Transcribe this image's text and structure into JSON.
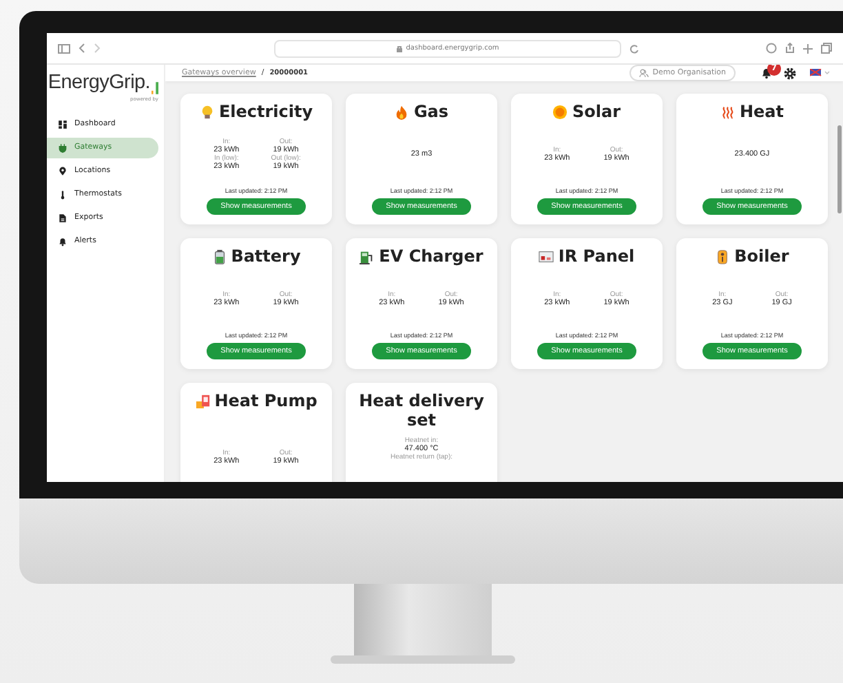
{
  "browser": {
    "url": "dashboard.energygrip.com"
  },
  "brand": {
    "name": "EnergyGrip.",
    "tagline": "powered by"
  },
  "sidebar": {
    "items": [
      {
        "label": "Dashboard",
        "selected": false
      },
      {
        "label": "Gateways",
        "selected": true
      },
      {
        "label": "Locations",
        "selected": false
      },
      {
        "label": "Thermostats",
        "selected": false
      },
      {
        "label": "Exports",
        "selected": false
      },
      {
        "label": "Alerts",
        "selected": false
      }
    ]
  },
  "breadcrumb": {
    "link": "Gateways overview",
    "separator": "/",
    "current": "20000001"
  },
  "topbar": {
    "organisation": "Demo Organisation",
    "notification_count": "7"
  },
  "cards": [
    {
      "title": "Electricity",
      "kind": "pair",
      "readings": [
        {
          "label": "In:",
          "value": "23 kWh"
        },
        {
          "label": "Out:",
          "value": "19 kWh"
        },
        {
          "label": "In (low):",
          "value": "23 kWh"
        },
        {
          "label": "Out (low):",
          "value": "19 kWh"
        }
      ],
      "updated": "Last updated: 2:12 PM",
      "button": "Show measurements"
    },
    {
      "title": "Gas",
      "kind": "single",
      "readings": [
        {
          "value": "23 m3"
        }
      ],
      "updated": "Last updated: 2:12 PM",
      "button": "Show measurements"
    },
    {
      "title": "Solar",
      "kind": "pair",
      "readings": [
        {
          "label": "In:",
          "value": "23 kWh"
        },
        {
          "label": "Out:",
          "value": "19 kWh"
        }
      ],
      "updated": "Last updated: 2:12 PM",
      "button": "Show measurements"
    },
    {
      "title": "Heat",
      "kind": "single",
      "readings": [
        {
          "value": "23.400 GJ"
        }
      ],
      "updated": "Last updated: 2:12 PM",
      "button": "Show measurements"
    },
    {
      "title": "Battery",
      "kind": "pair",
      "readings": [
        {
          "label": "In:",
          "value": "23 kWh"
        },
        {
          "label": "Out:",
          "value": "19 kWh"
        }
      ],
      "updated": "Last updated: 2:12 PM",
      "button": "Show measurements"
    },
    {
      "title": "EV Charger",
      "kind": "pair",
      "readings": [
        {
          "label": "In:",
          "value": "23 kWh"
        },
        {
          "label": "Out:",
          "value": "19 kWh"
        }
      ],
      "updated": "Last updated: 2:12 PM",
      "button": "Show measurements"
    },
    {
      "title": "IR Panel",
      "kind": "pair",
      "readings": [
        {
          "label": "In:",
          "value": "23 kWh"
        },
        {
          "label": "Out:",
          "value": "19 kWh"
        }
      ],
      "updated": "Last updated: 2:12 PM",
      "button": "Show measurements"
    },
    {
      "title": "Boiler",
      "kind": "pair",
      "readings": [
        {
          "label": "In:",
          "value": "23 GJ"
        },
        {
          "label": "Out:",
          "value": "19 GJ"
        }
      ],
      "updated": "Last updated: 2:12 PM",
      "button": "Show measurements"
    },
    {
      "title": "Heat Pump",
      "kind": "pair",
      "readings": [
        {
          "label": "In:",
          "value": "23 kWh"
        },
        {
          "label": "Out:",
          "value": "19 kWh"
        }
      ]
    },
    {
      "title": "Heat delivery set",
      "kind": "list",
      "readings": [
        {
          "label": "Heatnet in:",
          "value": "47.400 °C"
        },
        {
          "label": "Heatnet return (tap):"
        }
      ]
    }
  ]
}
